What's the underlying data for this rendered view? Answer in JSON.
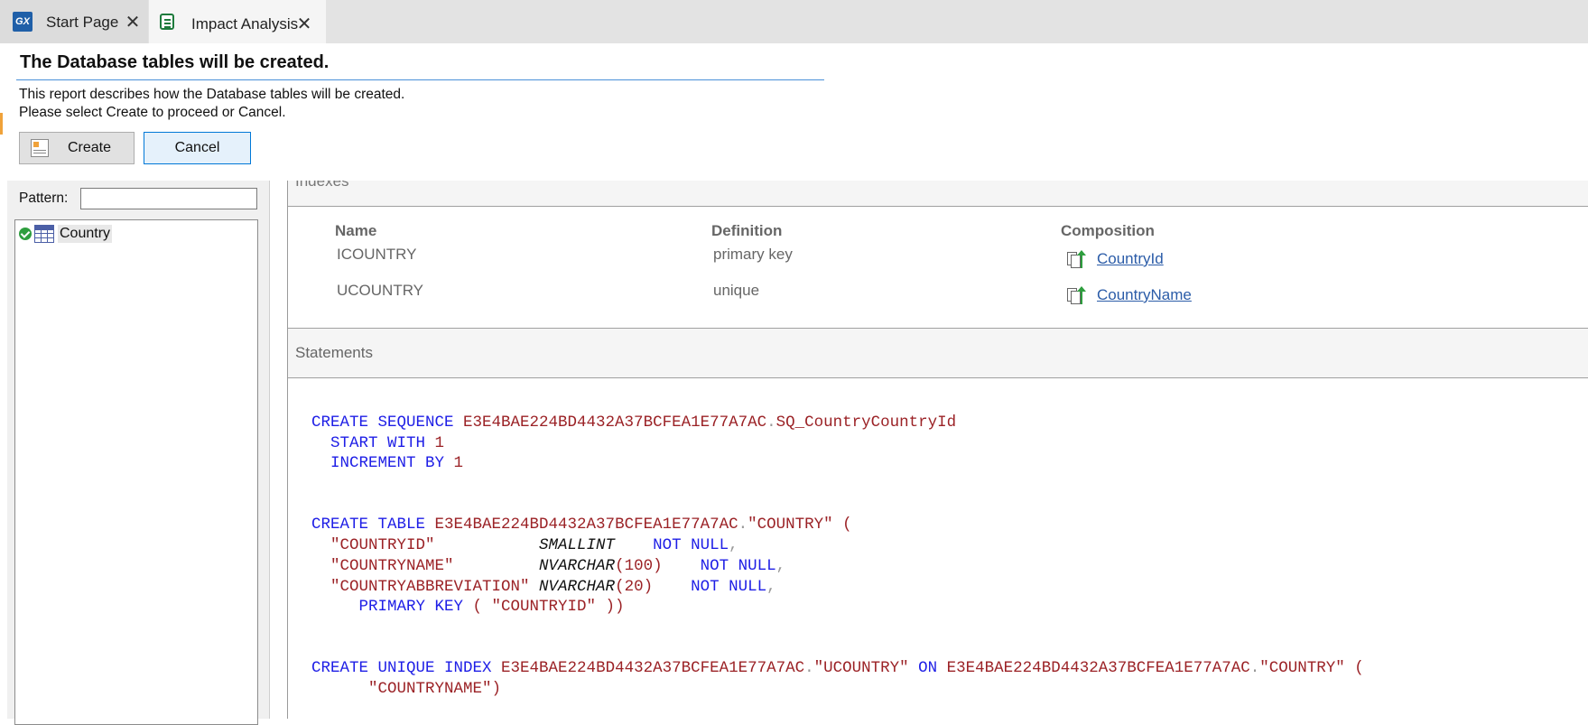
{
  "tabs": [
    {
      "icon": "gx-logo-icon",
      "icon_text": "GX",
      "label": "Start Page"
    },
    {
      "icon": "impact-sheet-icon",
      "label": "Impact Analysis"
    }
  ],
  "header": {
    "title": "The Database tables will be created.",
    "line1": "This report describes how the Database tables will be created.",
    "line2": "Please select Create to proceed or Cancel.",
    "create_label": "Create",
    "cancel_label": "Cancel"
  },
  "left_pane": {
    "pattern_label": "Pattern:",
    "pattern_value": "",
    "tree_items": [
      {
        "label": "Country",
        "status": "ok"
      }
    ]
  },
  "indexes": {
    "title": "Indexes",
    "columns": [
      "Name",
      "Definition",
      "Composition"
    ],
    "rows": [
      {
        "name": "ICOUNTRY",
        "definition": "primary key",
        "composition": "CountryId"
      },
      {
        "name": "UCOUNTRY",
        "definition": "unique",
        "composition": "CountryName"
      }
    ]
  },
  "statements": {
    "title": "Statements",
    "lines": [
      [
        [
          "kw",
          "CREATE SEQUENCE "
        ],
        [
          "id",
          "E3E4BAE224BD4432A37BCFEA1E77A7AC"
        ],
        [
          "pu",
          "."
        ],
        [
          "id",
          "SQ_CountryCountryId"
        ]
      ],
      [
        [
          "kw",
          "  START WITH "
        ],
        [
          "id",
          "1"
        ]
      ],
      [
        [
          "kw",
          "  INCREMENT BY "
        ],
        [
          "id",
          "1"
        ]
      ],
      [],
      [],
      [
        [
          "kw",
          "CREATE TABLE "
        ],
        [
          "id",
          "E3E4BAE224BD4432A37BCFEA1E77A7AC"
        ],
        [
          "pu",
          "."
        ],
        [
          "id",
          "\"COUNTRY\" ("
        ]
      ],
      [
        [
          "id",
          "  \"COUNTRYID\"           "
        ],
        [
          "ty",
          "SMALLINT"
        ],
        [
          "kw",
          "    NOT NULL"
        ],
        [
          "pu",
          ","
        ]
      ],
      [
        [
          "id",
          "  \"COUNTRYNAME\"         "
        ],
        [
          "ty",
          "NVARCHAR"
        ],
        [
          "id",
          "(100)"
        ],
        [
          "kw",
          "    NOT NULL"
        ],
        [
          "pu",
          ","
        ]
      ],
      [
        [
          "id",
          "  \"COUNTRYABBREVIATION\" "
        ],
        [
          "ty",
          "NVARCHAR"
        ],
        [
          "id",
          "(20)"
        ],
        [
          "kw",
          "    NOT NULL"
        ],
        [
          "pu",
          ","
        ]
      ],
      [
        [
          "kw",
          "     PRIMARY KEY"
        ],
        [
          "id",
          " ( \"COUNTRYID\" ))"
        ]
      ],
      [],
      [],
      [
        [
          "kw",
          "CREATE UNIQUE INDEX "
        ],
        [
          "id",
          "E3E4BAE224BD4432A37BCFEA1E77A7AC"
        ],
        [
          "pu",
          "."
        ],
        [
          "id",
          "\"UCOUNTRY\" "
        ],
        [
          "kw",
          "ON "
        ],
        [
          "id",
          "E3E4BAE224BD4432A37BCFEA1E77A7AC"
        ],
        [
          "pu",
          "."
        ],
        [
          "id",
          "\"COUNTRY\" ("
        ]
      ],
      [
        [
          "id",
          "      \"COUNTRYNAME\")"
        ]
      ]
    ]
  }
}
